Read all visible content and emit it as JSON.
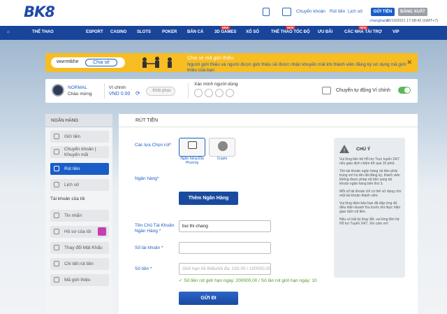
{
  "header": {
    "logo": "BK8",
    "links": [
      "Chuyển khoản",
      "Rút tiền",
      "Lịch sử"
    ],
    "deposit_btn": "GỬI TIỀN",
    "logout_btn": "ĐĂNG XUẤT",
    "username": "changhana",
    "datetime": "26/10/2021 17:08:42 (GMT+7)"
  },
  "nav": {
    "items": [
      "THỂ THAO",
      "ESPORT",
      "CASINO",
      "SLOTS",
      "POKER",
      "BẮN CÁ",
      "3D GAMES",
      "XỔ SỐ",
      "THỂ THAO TỐC ĐỘ",
      "ƯU ĐÃI",
      "CÁC NHÀ TÀI TRỢ",
      "VIP"
    ],
    "new_badge": "NEW"
  },
  "promo": {
    "ref_code": "wwrmtkhe",
    "share_btn": "Chia sẻ",
    "title": "Chia sẻ mã giới thiệu.",
    "text": "Người giới thiệu và người được giới thiệu sẽ được nhận khuyến mãi khi thành viên đăng ký sử dụng mã giới thiệu của bạn"
  },
  "account": {
    "level": "NORMAL",
    "greeting": "Chào mừng",
    "wallet_label": "Ví chính",
    "wallet_value": "VND 0.00",
    "restore_btn": "Khôi phục",
    "verify_label": "Xác minh người dùng",
    "auto_transfer_label": "Chuyển tự động Ví chính"
  },
  "sidebar": {
    "bank_header": "NGÂN HÀNG",
    "items": [
      "Gửi tiền",
      "Chuyển khoản | Khuyến mãi",
      "Rút tiền",
      "Lịch sử"
    ],
    "account_header": "Tài khoản của tôi",
    "account_items": [
      "Tin nhắn",
      "Hồ sơ của tôi",
      "Thay đổi Mật Khẩu",
      "Chi tiết rút tiền",
      "Mã giới thiệu"
    ]
  },
  "main": {
    "title": "RÚT TIỀN",
    "choose_label": "Các lựa Chọn rút*",
    "methods": [
      "Ngân hàng Địa Phương",
      "Crypto"
    ],
    "bank_label": "Ngân hàng*",
    "add_bank_btn": "Thêm Ngân Hàng",
    "holder_label": "Tên Chủ Tài Khoản Ngân Hàng *",
    "holder_value": "bui thi chang",
    "account_no_label": "Số tài khoản *",
    "amount_label": "Số tiền *",
    "amount_placeholder": "Giới hạn tối thiểu/tối đa: 150.00 / 100000.00",
    "limit_amount": "Số tiền rút giới hạn ngày: 200000.00",
    "limit_count": "Số lần rút giới hạn ngày: 10",
    "submit_btn": "GỬI ĐI"
  },
  "note": {
    "title": "CHÚ Ý",
    "items": [
      "Vui lòng liên hệ Hỗ trợ Trực tuyến 24/7 nếu giao dịch chậm trễ quá 10 phút.",
      "Tên tài khoản ngân hàng rút tiền phải trùng với họ tên đã đăng ký, thành viên không được phép rút tiền sang tài khoản ngân hàng bên thứ 3.",
      "Mỗi số tài khoản chỉ có thể sử dụng cho một tài khoản thành viên.",
      "Vui lòng đảm bảo bạn đã đáp ứng đủ điều kiện doanh thu trước khi thực hiện giao dịch rút tiền.",
      "Nếu có bất kỳ thay đổi, vui lòng liên hệ Hỗ trợ Tuyến 24/7. Xin cảm ơn!"
    ]
  }
}
